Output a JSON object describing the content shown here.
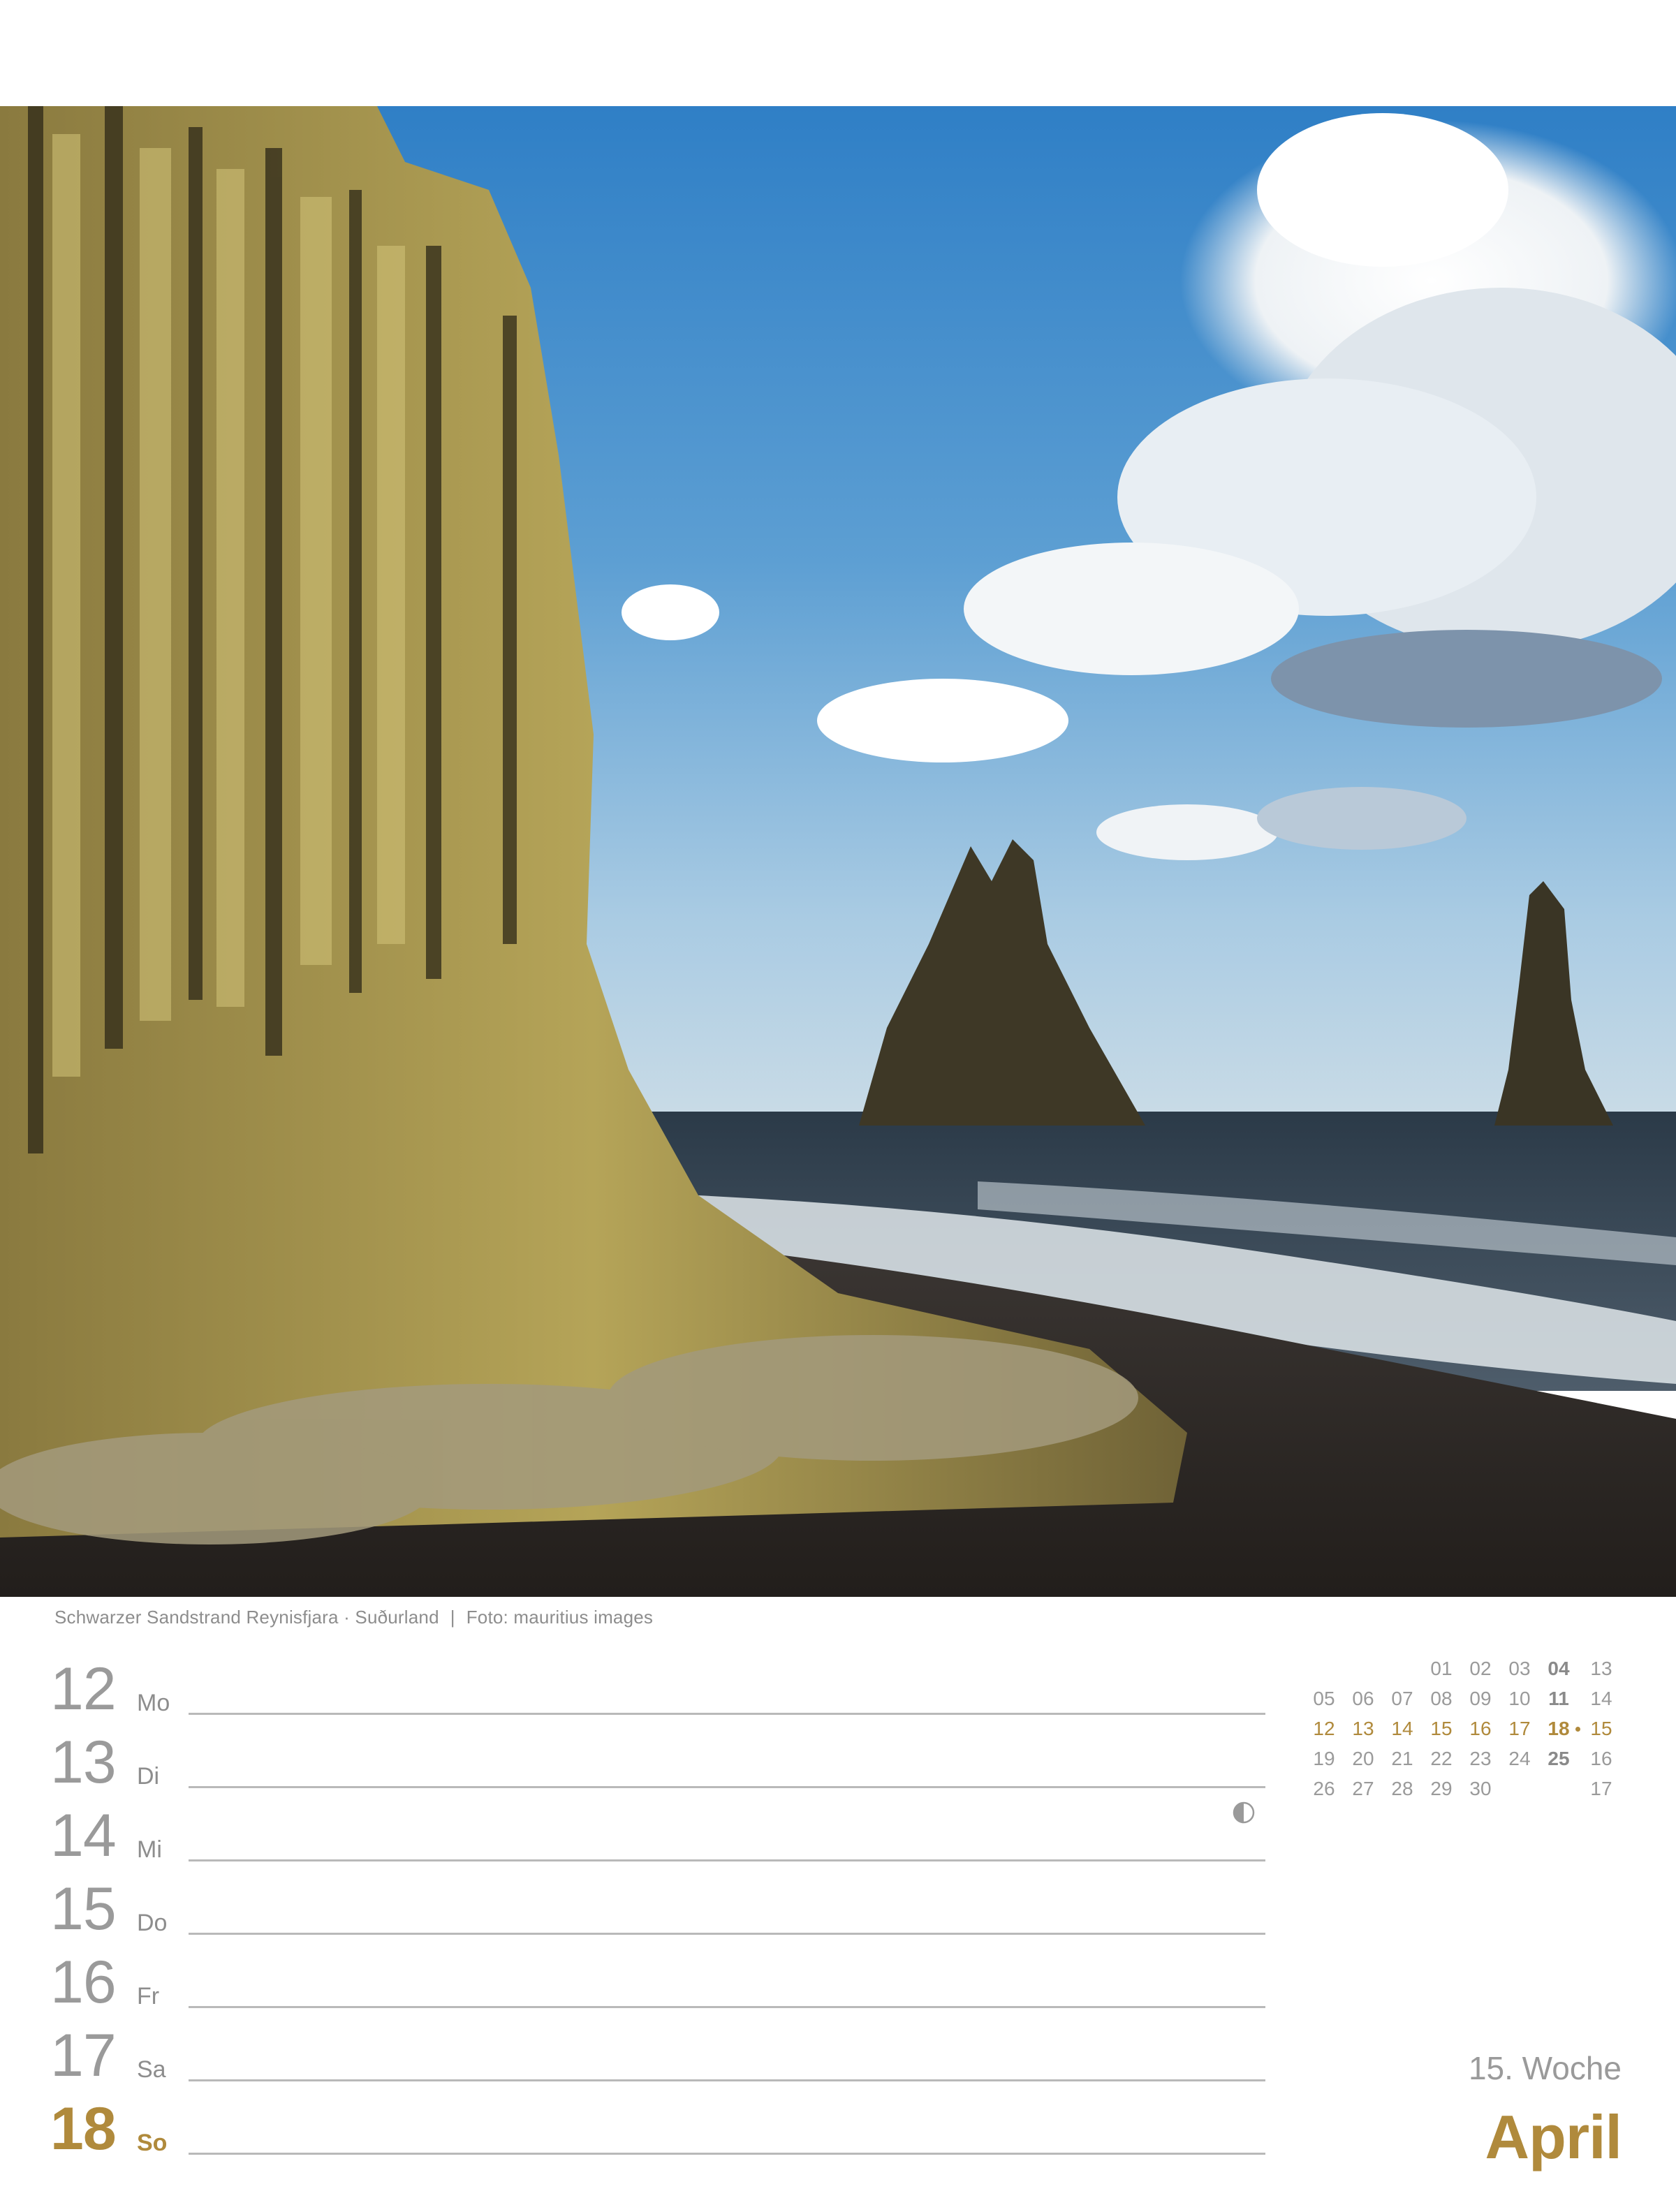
{
  "photo": {
    "subject": "black-sand-beach-with-basalt-columns-and-sea-stacks"
  },
  "caption": {
    "location": "Schwarzer Sandstrand Reynisfjara · Suðurland",
    "separator": "|",
    "credit": "Foto: mauritius images"
  },
  "days": [
    {
      "num": "12",
      "name": "Mo"
    },
    {
      "num": "13",
      "name": "Di"
    },
    {
      "num": "14",
      "name": "Mi"
    },
    {
      "num": "15",
      "name": "Do"
    },
    {
      "num": "16",
      "name": "Fr"
    },
    {
      "num": "17",
      "name": "Sa"
    },
    {
      "num": "18",
      "name": "So"
    }
  ],
  "moon_phase_icon": "half-moon-icon",
  "mini_calendar": {
    "rows": [
      {
        "cells": [
          "",
          "",
          "",
          "01",
          "02",
          "03",
          "04"
        ],
        "week": "13"
      },
      {
        "cells": [
          "05",
          "06",
          "07",
          "08",
          "09",
          "10",
          "11"
        ],
        "week": "14"
      },
      {
        "cells": [
          "12",
          "13",
          "14",
          "15",
          "16",
          "17",
          "18"
        ],
        "week": "15"
      },
      {
        "cells": [
          "19",
          "20",
          "21",
          "22",
          "23",
          "24",
          "25"
        ],
        "week": "16"
      },
      {
        "cells": [
          "26",
          "27",
          "28",
          "29",
          "30",
          "",
          ""
        ],
        "week": "17"
      }
    ]
  },
  "week_label": "15. Woche",
  "month_label": "April",
  "colors": {
    "accent_gold": "#b08a3c",
    "text_gray": "#9a9a9a",
    "rule_gray": "#b9b9b9"
  }
}
